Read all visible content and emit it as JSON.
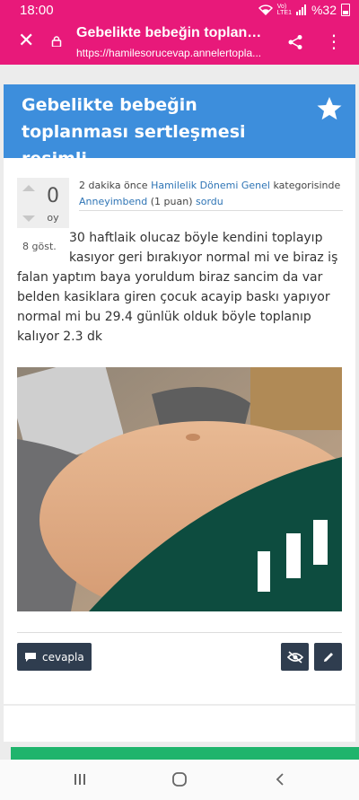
{
  "status_bar": {
    "time": "18:00",
    "signal_top": "Vo)",
    "signal_bottom": "LTE1",
    "battery": "%32"
  },
  "browser": {
    "page_title": "Gebelikte bebeğin toplanma...",
    "url": "https://hamilesorucevap.annelertopla...",
    "close_icon": "close-icon",
    "lock_icon": "lock-icon",
    "share_icon": "share-icon",
    "menu_icon": "more-vert-icon"
  },
  "question": {
    "title": "Gebelikte bebeğin toplanması sertleşmesi resimli",
    "votes": "0",
    "votes_label": "oy",
    "views": "8 göst.",
    "meta": {
      "time": "2 dakika önce",
      "category": "Hamilelik Dönemi Genel",
      "category_suffix": "kategorisinde",
      "author": "Anneyimbend",
      "points": "(1 puan)",
      "action": "sordu"
    },
    "text_first": "30 haftlaik olucaz böyle kendini toplayıp kasıyor geri bırakıyor normal mi ve biraz iş",
    "text_rest": "falan yaptım baya yoruldum biraz sancim da var belden kasiklara giren çocuk acayip baskı yapıyor normal mi bu 29.4 günlük olduk böyle toplanıp kalıyor 2.3 dk"
  },
  "actions": {
    "reply_label": "cevapla",
    "hide_icon": "eye-off-icon",
    "edit_icon": "pencil-icon"
  },
  "colors": {
    "brand_pink": "#e8197a",
    "header_blue": "#3d8edc",
    "button_dark": "#2f3d4f",
    "green": "#1fb46c"
  }
}
